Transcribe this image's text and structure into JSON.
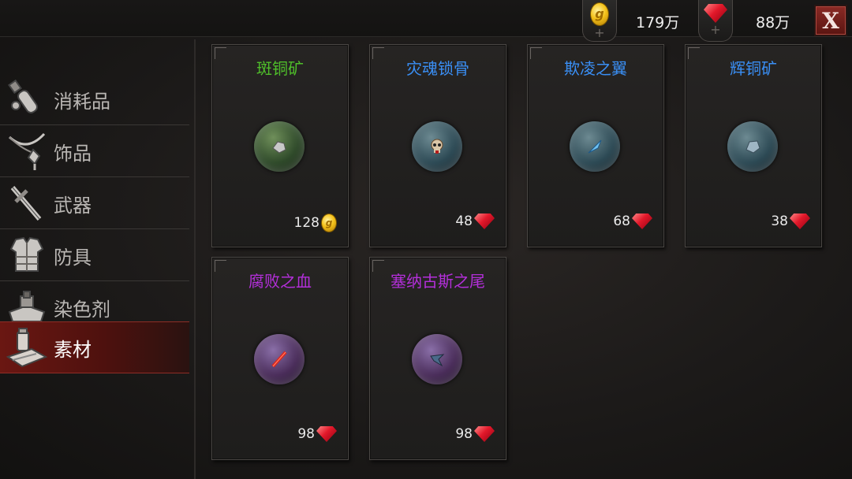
{
  "currency": {
    "gold_amount": "179万",
    "gem_amount": "88万",
    "close_label": "X",
    "gold_glyph": "g",
    "plus_glyph": "+"
  },
  "sidebar": {
    "items": [
      {
        "label": "消耗品",
        "icon": "potion-icon"
      },
      {
        "label": "饰品",
        "icon": "necklace-icon"
      },
      {
        "label": "武器",
        "icon": "sword-icon"
      },
      {
        "label": "防具",
        "icon": "armor-icon"
      },
      {
        "label": "染色剂",
        "icon": "dye-icon"
      },
      {
        "label": "素材",
        "icon": "material-icon"
      }
    ],
    "active_index": 5
  },
  "items": [
    {
      "name": "斑铜矿",
      "name_color": "#4fbf2a",
      "orb_color": "#2f5a2a",
      "price": "128",
      "currency": "gold"
    },
    {
      "name": "灾魂锁骨",
      "name_color": "#3a8ff5",
      "orb_color": "#2d4a55",
      "price": "48",
      "currency": "gem"
    },
    {
      "name": "欺凌之翼",
      "name_color": "#3a8ff5",
      "orb_color": "#2d4a55",
      "price": "68",
      "currency": "gem"
    },
    {
      "name": "辉铜矿",
      "name_color": "#3a8ff5",
      "orb_color": "#2d4a55",
      "price": "38",
      "currency": "gem"
    },
    {
      "name": "腐败之血",
      "name_color": "#b32fd9",
      "orb_color": "#4a2d5a",
      "price": "98",
      "currency": "gem"
    },
    {
      "name": "塞纳古斯之尾",
      "name_color": "#b32fd9",
      "orb_color": "#4a2d5a",
      "price": "98",
      "currency": "gem"
    }
  ]
}
